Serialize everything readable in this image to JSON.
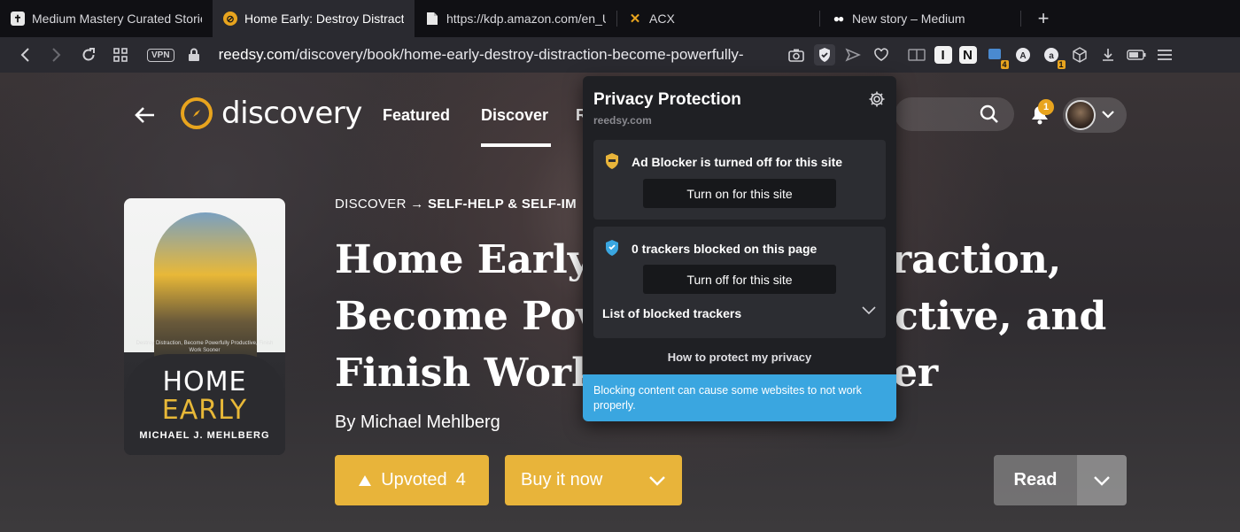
{
  "browser": {
    "tabs": [
      {
        "title": "Medium Mastery Curated Storie",
        "icon": "medium-mastery-icon",
        "active": false
      },
      {
        "title": "Home Early: Destroy Distraction",
        "icon": "reedsy-icon",
        "active": true
      },
      {
        "title": "https://kdp.amazon.com/en_US",
        "icon": "document-icon",
        "active": false
      },
      {
        "title": "ACX",
        "icon": "acx-icon",
        "active": false
      },
      {
        "title": "New story – Medium",
        "icon": "medium-icon",
        "active": false
      }
    ],
    "vpn_label": "VPN",
    "url": {
      "host": "reedsy.com",
      "path": "/discovery/book/home-early-destroy-distraction-become-powerfully-"
    },
    "extension_badges": {
      "books": "4",
      "ayt": "1"
    }
  },
  "site": {
    "logo_text": "discovery",
    "nav": [
      "Featured",
      "Discover",
      "R"
    ],
    "notification_count": "1"
  },
  "book": {
    "breadcrumb_root": "DISCOVER",
    "breadcrumb_arrow": "→",
    "breadcrumb_current": "SELF-HELP & SELF-IM",
    "title_lines": [
      "Home Early",
      "Become Pov",
      "Finish Work"
    ],
    "title_tails": [
      "raction,",
      "ctive, and",
      "er"
    ],
    "byline": "By Michael Mehlberg",
    "upvote_label": "Upvoted",
    "upvote_count": "4",
    "buy_label": "Buy it now",
    "read_label": "Read",
    "cover": {
      "subtitle": "Destroy Distraction, Become Powerfully Productive, Finish Work Sooner",
      "title_top": "HOME",
      "title_bottom": "EARLY",
      "author": "MICHAEL J. MEHLBERG"
    }
  },
  "privacy": {
    "title": "Privacy Protection",
    "domain": "reedsy.com",
    "ad_blocker_text": "Ad Blocker is turned off for this site",
    "ad_blocker_button": "Turn on for this site",
    "trackers_text": "0 trackers blocked on this page",
    "trackers_button": "Turn off for this site",
    "list_label": "List of blocked trackers",
    "how_link": "How to protect my privacy",
    "warning": "Blocking content can cause some websites to not work properly."
  },
  "colors": {
    "accent": "#e8b43a",
    "info": "#3aa6e0"
  }
}
